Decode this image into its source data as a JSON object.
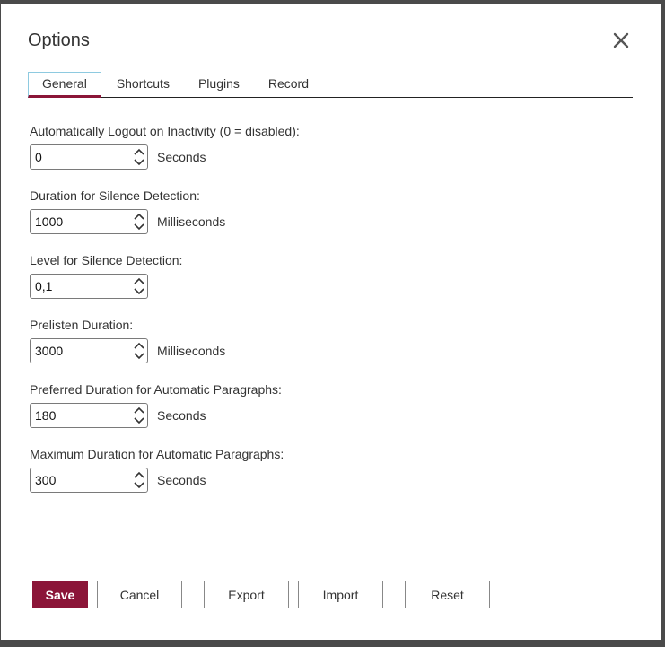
{
  "dialog": {
    "title": "Options",
    "close_icon": "close-icon"
  },
  "tabs": [
    {
      "label": "General",
      "active": true
    },
    {
      "label": "Shortcuts",
      "active": false
    },
    {
      "label": "Plugins",
      "active": false
    },
    {
      "label": "Record",
      "active": false
    }
  ],
  "fields": {
    "logout": {
      "label": "Automatically Logout on Inactivity (0 = disabled):",
      "value": "0",
      "unit": "Seconds"
    },
    "silence_duration": {
      "label": "Duration for Silence Detection:",
      "value": "1000",
      "unit": "Milliseconds"
    },
    "silence_level": {
      "label": "Level for Silence Detection:",
      "value": "0,1",
      "unit": ""
    },
    "prelisten": {
      "label": "Prelisten Duration:",
      "value": "3000",
      "unit": "Milliseconds"
    },
    "preferred_paragraph": {
      "label": "Preferred Duration for Automatic Paragraphs:",
      "value": "180",
      "unit": "Seconds"
    },
    "max_paragraph": {
      "label": "Maximum Duration for Automatic Paragraphs:",
      "value": "300",
      "unit": "Seconds"
    }
  },
  "buttons": {
    "save": "Save",
    "cancel": "Cancel",
    "export": "Export",
    "import": "Import",
    "reset": "Reset"
  },
  "colors": {
    "accent": "#8b1538",
    "tab_border": "#8ecae0"
  }
}
